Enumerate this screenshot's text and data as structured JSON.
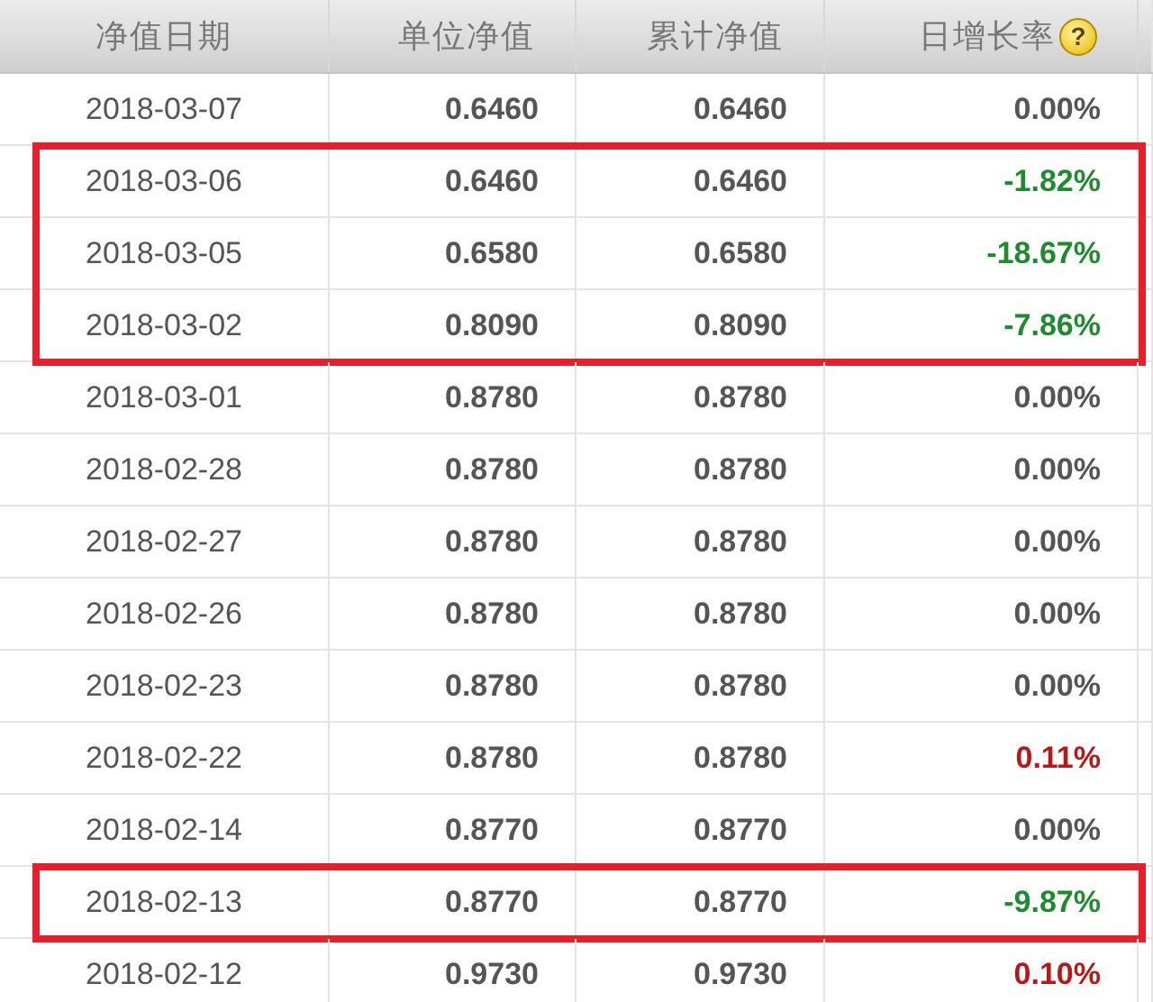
{
  "table": {
    "columns": [
      {
        "label": "净值日期"
      },
      {
        "label": "单位净值"
      },
      {
        "label": "累计净值"
      },
      {
        "label": "日增长率",
        "help": "?"
      }
    ],
    "rows": [
      {
        "date": "2018-03-07",
        "unit": "0.6460",
        "total": "0.6460",
        "growth": "0.00%",
        "color": "#555555",
        "boxed": false
      },
      {
        "date": "2018-03-06",
        "unit": "0.6460",
        "total": "0.6460",
        "growth": "-1.82%",
        "color": "#1f8a2f",
        "boxed": true
      },
      {
        "date": "2018-03-05",
        "unit": "0.6580",
        "total": "0.6580",
        "growth": "-18.67%",
        "color": "#1f8a2f",
        "boxed": true
      },
      {
        "date": "2018-03-02",
        "unit": "0.8090",
        "total": "0.8090",
        "growth": "-7.86%",
        "color": "#1f8a2f",
        "boxed": true
      },
      {
        "date": "2018-03-01",
        "unit": "0.8780",
        "total": "0.8780",
        "growth": "0.00%",
        "color": "#555555",
        "boxed": false
      },
      {
        "date": "2018-02-28",
        "unit": "0.8780",
        "total": "0.8780",
        "growth": "0.00%",
        "color": "#555555",
        "boxed": false
      },
      {
        "date": "2018-02-27",
        "unit": "0.8780",
        "total": "0.8780",
        "growth": "0.00%",
        "color": "#555555",
        "boxed": false
      },
      {
        "date": "2018-02-26",
        "unit": "0.8780",
        "total": "0.8780",
        "growth": "0.00%",
        "color": "#555555",
        "boxed": false
      },
      {
        "date": "2018-02-23",
        "unit": "0.8780",
        "total": "0.8780",
        "growth": "0.00%",
        "color": "#555555",
        "boxed": false
      },
      {
        "date": "2018-02-22",
        "unit": "0.8780",
        "total": "0.8780",
        "growth": "0.11%",
        "color": "#b31b1b",
        "boxed": false
      },
      {
        "date": "2018-02-14",
        "unit": "0.8770",
        "total": "0.8770",
        "growth": "0.00%",
        "color": "#555555",
        "boxed": false
      },
      {
        "date": "2018-02-13",
        "unit": "0.8770",
        "total": "0.8770",
        "growth": "-9.87%",
        "color": "#1f8a2f",
        "boxed": true
      },
      {
        "date": "2018-02-12",
        "unit": "0.9730",
        "total": "0.9730",
        "growth": "0.10%",
        "color": "#b31b1b",
        "boxed": false
      }
    ]
  }
}
